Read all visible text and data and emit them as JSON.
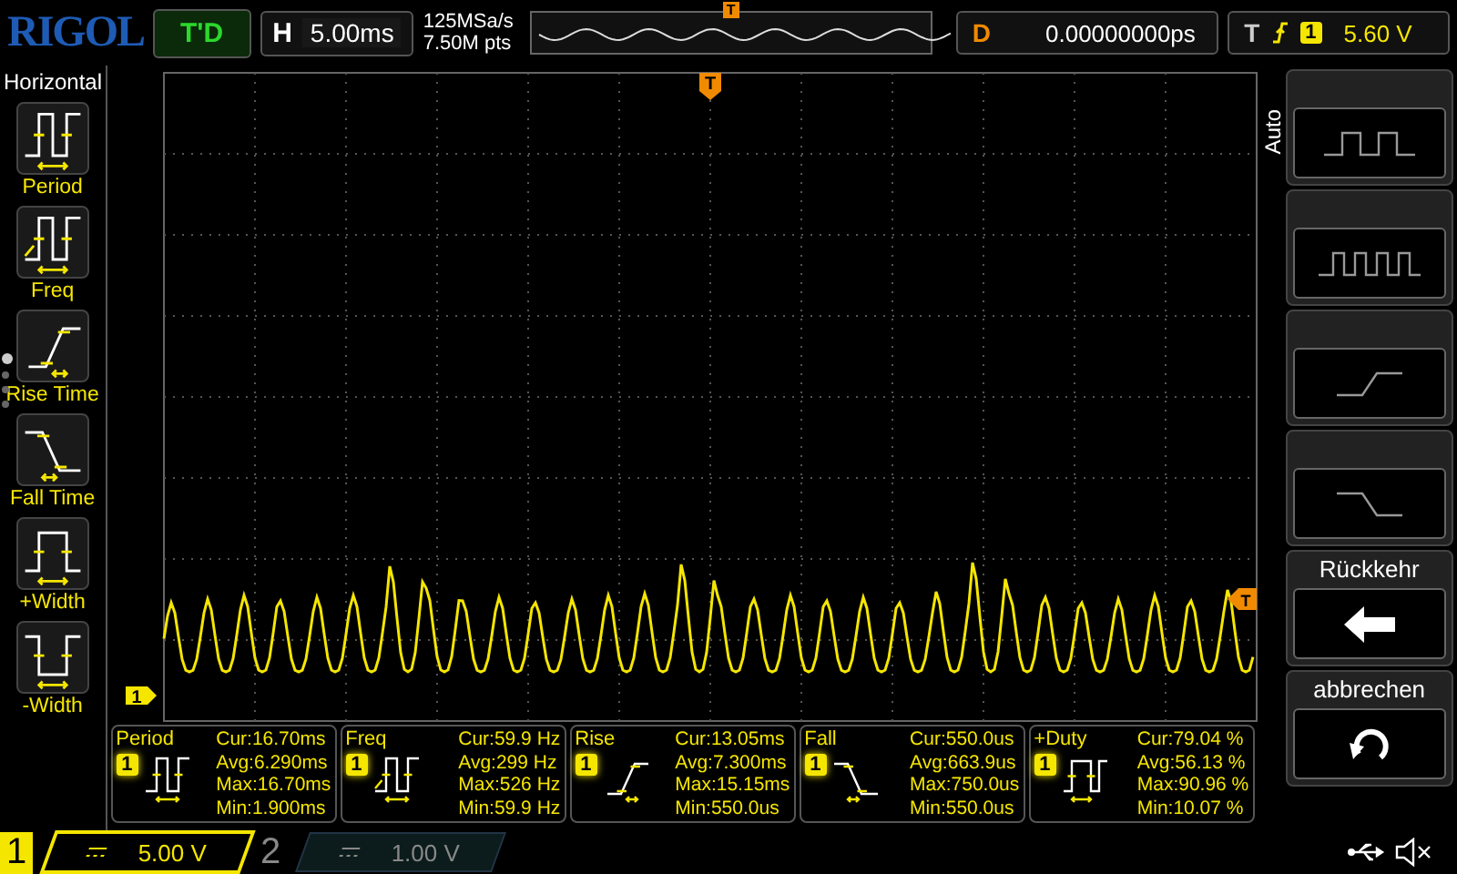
{
  "header": {
    "logo": "RIGOL",
    "run_status": "T'D",
    "timebase_label": "H",
    "timebase": "5.00ms",
    "sample_rate": "125MSa/s",
    "memory_depth": "7.50M pts",
    "delay_label": "D",
    "delay": "0.00000000ps",
    "trigger_label": "T",
    "trigger_channel": "1",
    "trigger_level": "5.60 V",
    "overview_marker": "T"
  },
  "sidebar": {
    "title": "Horizontal",
    "items": [
      {
        "kind": "period",
        "label": "Period"
      },
      {
        "kind": "freq",
        "label": "Freq"
      },
      {
        "kind": "rise",
        "label": "Rise Time"
      },
      {
        "kind": "fall",
        "label": "Fall Time"
      },
      {
        "kind": "pos_width",
        "label": "+Width"
      },
      {
        "kind": "neg_width",
        "label": "-Width"
      }
    ],
    "page_dots": [
      {
        "selected": true
      },
      {
        "selected": false
      },
      {
        "selected": false
      },
      {
        "selected": false
      }
    ]
  },
  "plot": {
    "trigger_marker": "T",
    "trigger_level_marker": "T",
    "channel_marker": "1"
  },
  "softkeys": {
    "side_label": "Auto",
    "keys": [
      {
        "kind": "pulse"
      },
      {
        "kind": "pulse_train"
      },
      {
        "kind": "rise"
      },
      {
        "kind": "fall"
      },
      {
        "kind": "back",
        "label": "Rückkehr"
      },
      {
        "kind": "undo",
        "label": "abbrechen"
      }
    ]
  },
  "measurements": [
    {
      "kind": "period",
      "name": "Period",
      "channel": "1",
      "cur": "Cur:16.70ms",
      "avg": "Avg:6.290ms",
      "max": "Max:16.70ms",
      "min": "Min:1.900ms"
    },
    {
      "kind": "freq",
      "name": "Freq",
      "channel": "1",
      "cur": "Cur:59.9 Hz",
      "avg": "Avg:299 Hz",
      "max": "Max:526 Hz",
      "min": "Min:59.9 Hz"
    },
    {
      "kind": "rise",
      "name": "Rise",
      "channel": "1",
      "cur": "Cur:13.05ms",
      "avg": "Avg:7.300ms",
      "max": "Max:15.15ms",
      "min": "Min:550.0us"
    },
    {
      "kind": "fall",
      "name": "Fall",
      "channel": "1",
      "cur": "Cur:550.0us",
      "avg": "Avg:663.9us",
      "max": "Max:750.0us",
      "min": "Min:550.0us"
    },
    {
      "kind": "duty",
      "name": "+Duty",
      "channel": "1",
      "cur": "Cur:79.04 %",
      "avg": "Avg:56.13 %",
      "max": "Max:90.96 %",
      "min": "Min:10.07 %"
    }
  ],
  "channels": [
    {
      "number": "1",
      "scale": "5.00 V",
      "on": true
    },
    {
      "number": "2",
      "scale": "1.00 V",
      "on": false
    }
  ]
}
